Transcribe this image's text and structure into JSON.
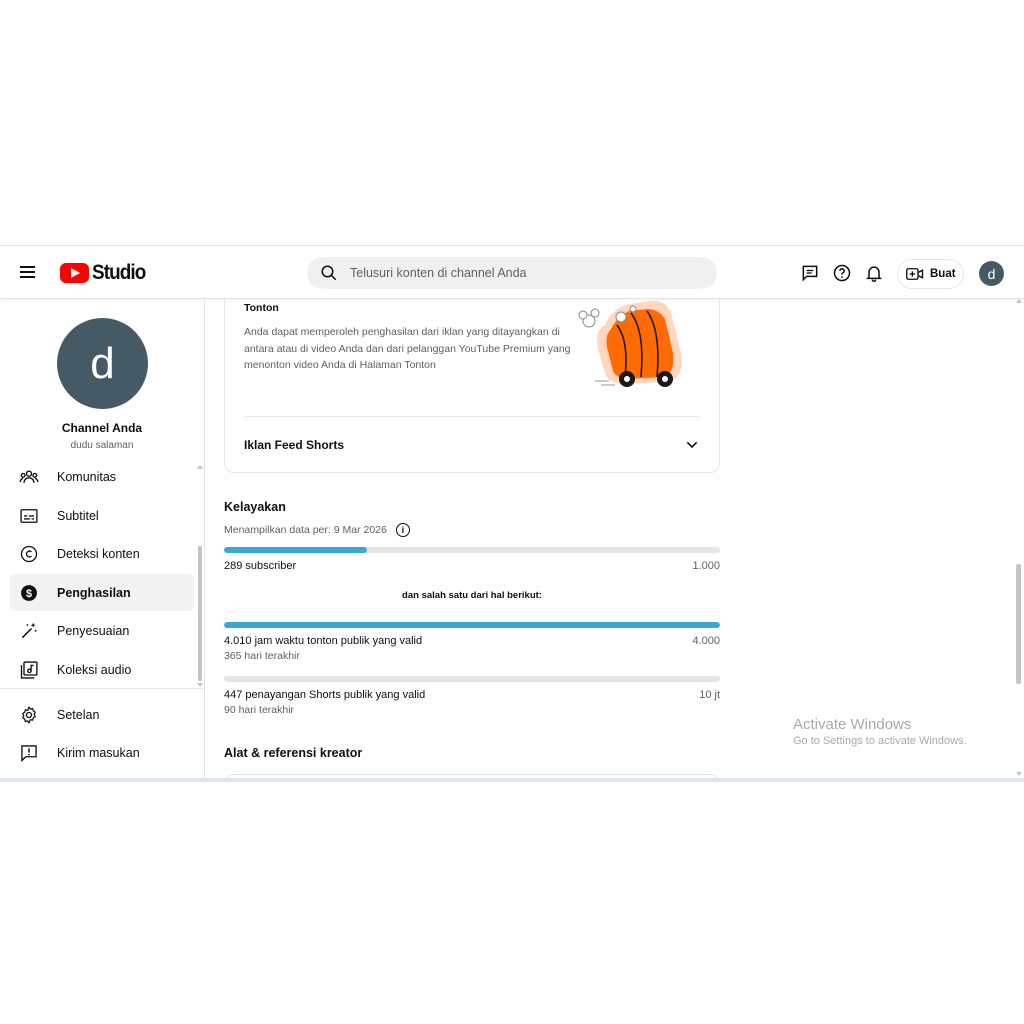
{
  "header": {
    "logo_text": "Studio",
    "search_placeholder": "Telusuri konten di channel Anda",
    "create_label": "Buat",
    "avatar_letter": "d"
  },
  "sidebar": {
    "avatar_letter": "d",
    "channel_name": "Channel Anda",
    "channel_sub": "dudu salaman",
    "items": [
      {
        "label": "Komunitas",
        "icon": "community-icon"
      },
      {
        "label": "Subtitel",
        "icon": "subtitles-icon"
      },
      {
        "label": "Deteksi konten",
        "icon": "copyright-icon"
      },
      {
        "label": "Penghasilan",
        "icon": "dollar-icon",
        "active": true
      },
      {
        "label": "Penyesuaian",
        "icon": "magic-wand-icon"
      },
      {
        "label": "Koleksi audio",
        "icon": "audio-library-icon"
      }
    ],
    "bottom_items": [
      {
        "label": "Setelan",
        "icon": "gear-icon"
      },
      {
        "label": "Kirim masukan",
        "icon": "feedback-icon"
      }
    ]
  },
  "main": {
    "card": {
      "title": "Tonton",
      "description": "Anda dapat memperoleh penghasilan dari iklan yang ditayangkan di antara atau di video Anda dan dari pelanggan YouTube Premium yang menonton video Anda di Halaman Tonton",
      "row_label": "Iklan Feed Shorts"
    },
    "eligibility": {
      "title": "Kelayakan",
      "data_date": "Menampilkan data per: 9 Mar 2026",
      "subscribers": {
        "label": "289 subscriber",
        "target": "1.000",
        "progress": 0.289
      },
      "or_text": "dan salah satu dari hal berikut:",
      "watch_hours": {
        "label": "4.010 jam waktu tonton publik yang valid",
        "target": "4.000",
        "sub": "365 hari terakhir",
        "progress": 1.0
      },
      "shorts_views": {
        "label": "447 penayangan Shorts publik yang valid",
        "target": "10 jt",
        "sub": "90 hari terakhir",
        "progress": 4.47e-05
      }
    },
    "tools_title": "Alat & referensi kreator"
  },
  "watermark": {
    "line1": "Activate Windows",
    "line2": "Go to Settings to activate Windows."
  },
  "colors": {
    "progress": "#3ea6d4",
    "logo_red": "#ff0000",
    "avatar": "#455a64"
  }
}
